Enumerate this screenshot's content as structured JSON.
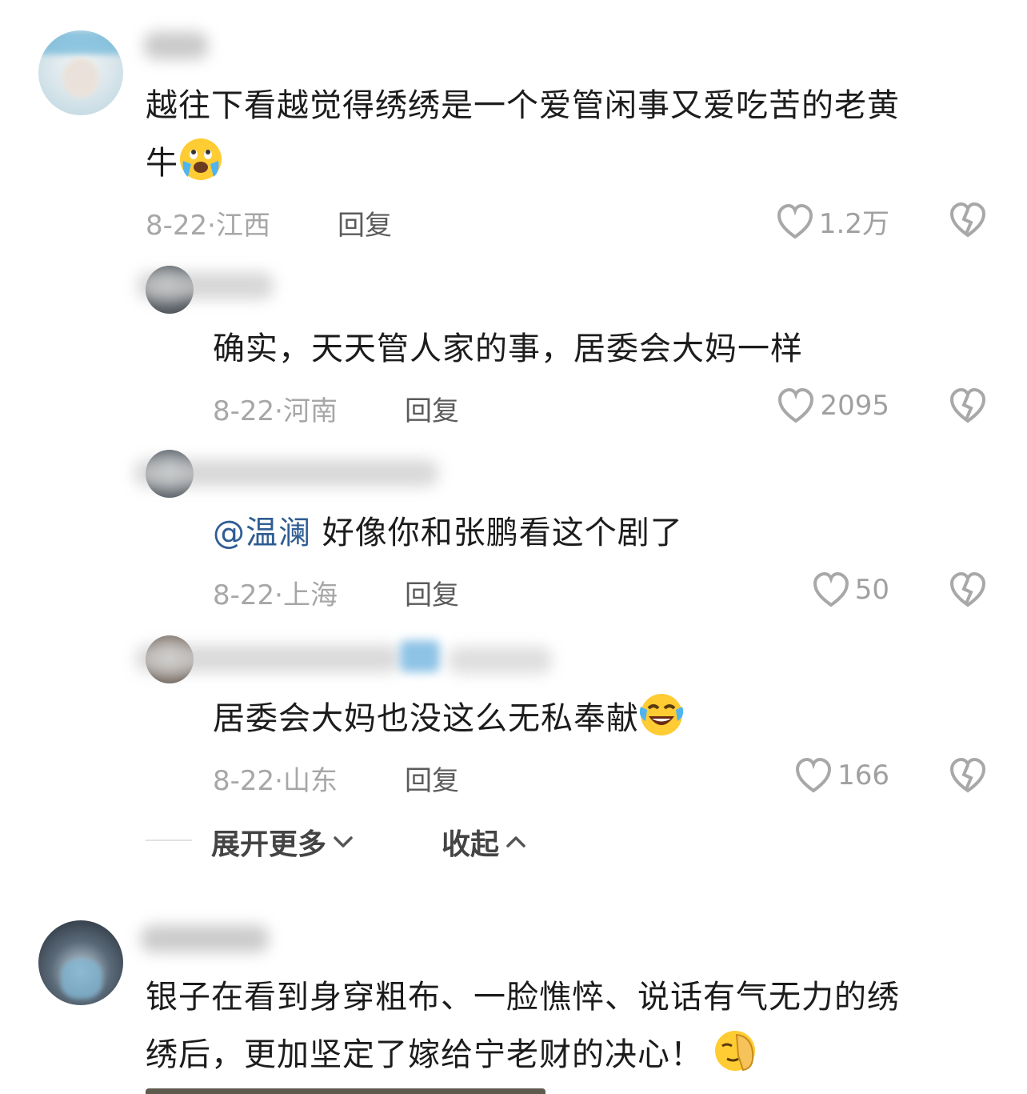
{
  "comments": [
    {
      "text": "越往下看越觉得绣绣是一个爱管闲事又爱吃苦的老黄",
      "text2": "牛",
      "emoji": "crying-face",
      "date": "8-22·",
      "location": "江西",
      "reply": "回复",
      "likes": "1.2万",
      "replies": [
        {
          "text": "确实，天天管人家的事，居委会大妈一样",
          "date": "8-22·",
          "location": "河南",
          "reply": "回复",
          "likes": "2095"
        },
        {
          "mention": "@温澜",
          "text": " 好像你和张鹏看这个剧了",
          "date": "8-22·",
          "location": "上海",
          "reply": "回复",
          "likes": "50"
        },
        {
          "text": "居委会大妈也没这么无私奉献",
          "emoji": "laughing-crying-face",
          "date": "8-22·",
          "location": "山东",
          "reply": "回复",
          "likes": "166"
        }
      ]
    },
    {
      "text": "银子在看到身穿粗布、一脸憔悴、说话有气无力的绣",
      "text2": "绣后，更加坚定了嫁给宁老财的决心！",
      "emoji": "face-palm-emoji"
    }
  ],
  "thread": {
    "expand_label": "展开更多",
    "collapse_label": "收起"
  },
  "colors": {
    "mention": "#2f5d93",
    "meta": "#a7a7a7"
  }
}
